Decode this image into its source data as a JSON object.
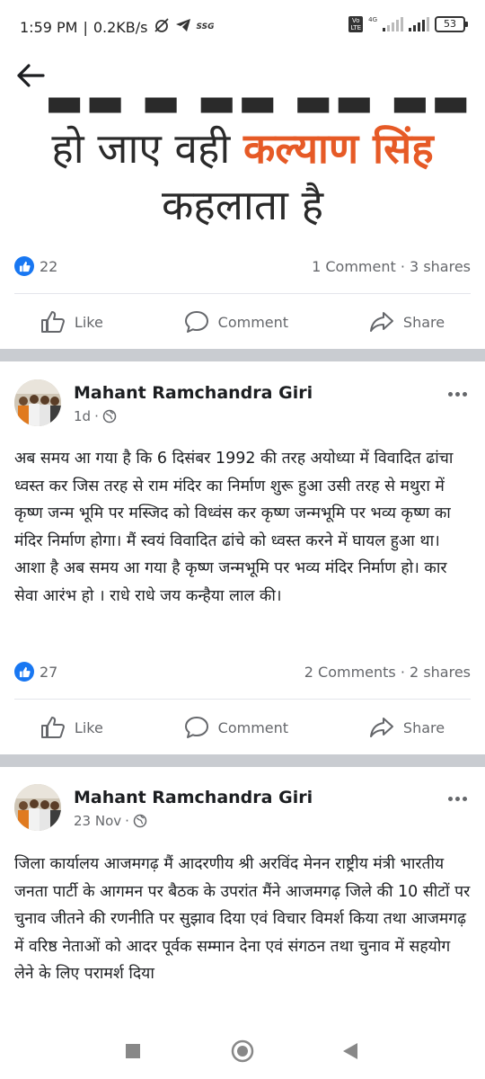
{
  "status_bar": {
    "time": "1:59 PM",
    "speed": "0.2KB/s",
    "ssg": "SSG",
    "volte_top": "Vo",
    "volte_bottom": "LTE",
    "network": "4G",
    "battery": "53"
  },
  "nav": {
    "back_icon": "arrow-left-icon"
  },
  "post_image": {
    "line1_dark": "हो जाए वही ",
    "line1_highlight": "कल्याण सिंह",
    "line2": "कहलाता है",
    "highlight_color": "#e65a26"
  },
  "post1": {
    "likes": "22",
    "comments": "1 Comment",
    "shares": "3 shares"
  },
  "post2": {
    "author": "Mahant Ramchandra Giri",
    "time": "1d",
    "text": "अब समय आ गया है कि 6 दिसंबर 1992 की तरह अयोध्या में विवादित ढांचा ध्वस्त कर जिस तरह से राम मंदिर का निर्माण शुरू हुआ उसी तरह से मथुरा में कृष्ण जन्म भूमि पर मस्जिद  को विध्वंस कर कृष्ण जन्मभूमि पर भव्य कृष्ण का मंदिर निर्माण होगा।  मैं स्वयं विवादित ढांचे को ध्वस्त करने में घायल हुआ था। आशा है अब समय आ गया है  कृष्ण जन्मभूमि पर भव्य मंदिर निर्माण हो। कार सेवा आरंभ हो । राधे राधे जय कन्हैया लाल की।",
    "likes": "27",
    "comments": "2 Comments",
    "shares": "2 shares"
  },
  "post3": {
    "author": "Mahant Ramchandra Giri",
    "time": "23 Nov",
    "text": "जिला कार्यालय आजमगढ़ मैं आदरणीय श्री अरविंद मेनन राष्ट्रीय मंत्री भारतीय जनता पार्टी के आगमन पर बैठक के उपरांत मैंने आजमगढ़ जिले की 10 सीटों पर चुनाव जीतने की रणनीति पर सुझाव दिया एवं विचार विमर्श किया तथा आजमगढ़ में वरिष्ठ नेताओं को आदर पूर्वक सम्मान देना एवं संगठन तथा चुनाव में सहयोग लेने के लिए परामर्श दिया"
  },
  "actions": {
    "like": "Like",
    "comment": "Comment",
    "share": "Share"
  },
  "separator_dot": "·",
  "colors": {
    "like_blue": "#1877f2",
    "muted_text": "#65676b",
    "separator": "#c9ccd1"
  }
}
